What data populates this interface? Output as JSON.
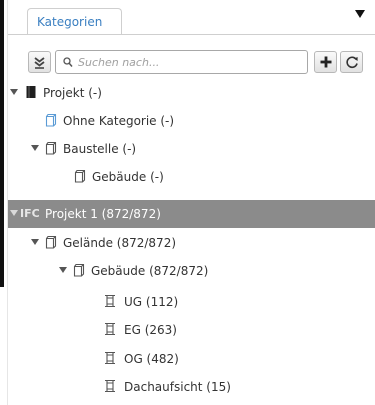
{
  "tabs": [
    {
      "label": "Kategorien",
      "active": true
    }
  ],
  "toolbar": {
    "collapse_icon": "collapse-all-icon",
    "search_placeholder": "Suchen nach...",
    "search_value": "",
    "add_icon": "plus-icon",
    "refresh_icon": "refresh-icon"
  },
  "tree": [
    {
      "label": "Projekt (-)",
      "icon": "project-book-icon",
      "expanded": true
    },
    {
      "label": "Ohne Kategorie (-)",
      "icon": "category-box-icon-blue"
    },
    {
      "label": "Baustelle (-)",
      "icon": "category-box-icon",
      "expanded": true
    },
    {
      "label": "Gebäude (-)",
      "icon": "category-box-icon"
    },
    {
      "tag": "IFC",
      "label": "Projekt 1 (872/872)",
      "selected": true,
      "expanded": true
    },
    {
      "label": "Gelände (872/872)",
      "icon": "category-box-icon",
      "expanded": true
    },
    {
      "label": "Gebäude (872/872)",
      "icon": "category-box-icon",
      "expanded": true
    },
    {
      "label": "UG (112)",
      "icon": "storey-icon"
    },
    {
      "label": "EG (263)",
      "icon": "storey-icon"
    },
    {
      "label": "OG (482)",
      "icon": "storey-icon"
    },
    {
      "label": "Dachaufsicht (15)",
      "icon": "storey-icon"
    }
  ],
  "colors": {
    "tab_text": "#3a7fc1",
    "selected_row": "#8b8b8b",
    "category_blue": "#5b9bd5"
  }
}
